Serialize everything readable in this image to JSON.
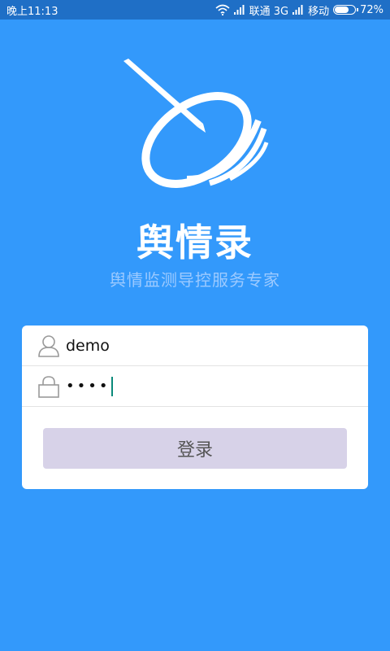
{
  "statusbar": {
    "time": "晚上11:13",
    "carrier1": "联通 3G",
    "carrier2": "移动",
    "battery_text": "72%",
    "battery_level": 0.72
  },
  "app": {
    "title": "舆情录",
    "subtitle": "舆情监测导控服务专家"
  },
  "login": {
    "username_value": "demo",
    "password_value": "••••",
    "button_label": "登录"
  },
  "colors": {
    "background": "#3399fb",
    "statusbar": "#1f6fc6",
    "button": "#d7d2e8"
  },
  "icons": {
    "username": "user-icon",
    "password": "lock-icon"
  }
}
